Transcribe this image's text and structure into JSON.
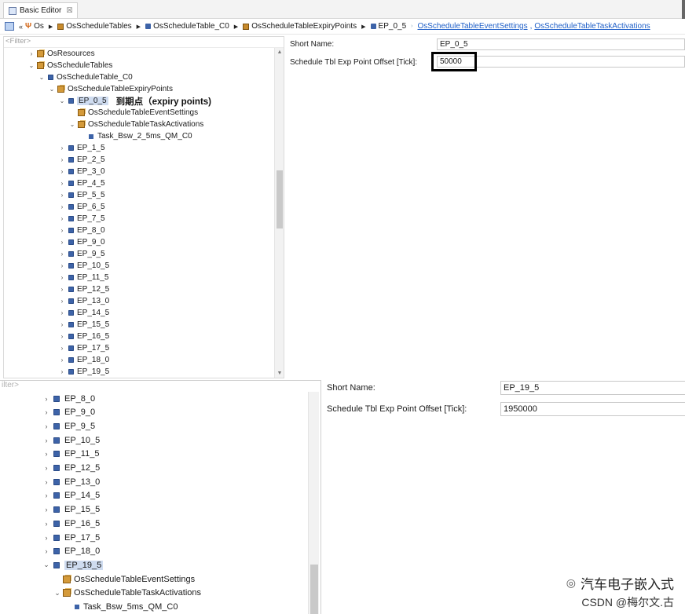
{
  "editor": {
    "tab_title": "Basic Editor",
    "tab_close": "☒"
  },
  "breadcrumb": {
    "items": [
      "Os",
      "OsScheduleTables",
      "OsScheduleTable_C0",
      "OsScheduleTableExpiryPoints",
      "EP_0_5"
    ],
    "links": [
      "OsScheduleTableEventSettings",
      "OsScheduleTableTaskActivations"
    ],
    "separator": ","
  },
  "upper_tree": {
    "filter_placeholder": "<Filter>",
    "nodes": [
      {
        "label": "OsResources",
        "level": 1,
        "toggle": ">",
        "icon": "module"
      },
      {
        "label": "OsScheduleTables",
        "level": 1,
        "toggle": "v",
        "icon": "module"
      },
      {
        "label": "OsScheduleTable_C0",
        "level": 2,
        "toggle": "v",
        "icon": "square"
      },
      {
        "label": "OsScheduleTableExpiryPoints",
        "level": 3,
        "toggle": "v",
        "icon": "module"
      },
      {
        "label": "EP_0_5",
        "level": 4,
        "toggle": "v",
        "icon": "square",
        "selected": true
      },
      {
        "label": "OsScheduleTableEventSettings",
        "level": 5,
        "toggle": "",
        "icon": "module"
      },
      {
        "label": "OsScheduleTableTaskActivations",
        "level": 5,
        "toggle": "v",
        "icon": "module"
      },
      {
        "label": "Task_Bsw_2_5ms_QM_C0",
        "level": 6,
        "toggle": "",
        "icon": "task"
      },
      {
        "label": "EP_1_5",
        "level": 4,
        "toggle": ">",
        "icon": "square"
      },
      {
        "label": "EP_2_5",
        "level": 4,
        "toggle": ">",
        "icon": "square"
      },
      {
        "label": "EP_3_0",
        "level": 4,
        "toggle": ">",
        "icon": "square"
      },
      {
        "label": "EP_4_5",
        "level": 4,
        "toggle": ">",
        "icon": "square"
      },
      {
        "label": "EP_5_5",
        "level": 4,
        "toggle": ">",
        "icon": "square"
      },
      {
        "label": "EP_6_5",
        "level": 4,
        "toggle": ">",
        "icon": "square"
      },
      {
        "label": "EP_7_5",
        "level": 4,
        "toggle": ">",
        "icon": "square"
      },
      {
        "label": "EP_8_0",
        "level": 4,
        "toggle": ">",
        "icon": "square"
      },
      {
        "label": "EP_9_0",
        "level": 4,
        "toggle": ">",
        "icon": "square"
      },
      {
        "label": "EP_9_5",
        "level": 4,
        "toggle": ">",
        "icon": "square"
      },
      {
        "label": "EP_10_5",
        "level": 4,
        "toggle": ">",
        "icon": "square"
      },
      {
        "label": "EP_11_5",
        "level": 4,
        "toggle": ">",
        "icon": "square"
      },
      {
        "label": "EP_12_5",
        "level": 4,
        "toggle": ">",
        "icon": "square"
      },
      {
        "label": "EP_13_0",
        "level": 4,
        "toggle": ">",
        "icon": "square"
      },
      {
        "label": "EP_14_5",
        "level": 4,
        "toggle": ">",
        "icon": "square"
      },
      {
        "label": "EP_15_5",
        "level": 4,
        "toggle": ">",
        "icon": "square"
      },
      {
        "label": "EP_16_5",
        "level": 4,
        "toggle": ">",
        "icon": "square"
      },
      {
        "label": "EP_17_5",
        "level": 4,
        "toggle": ">",
        "icon": "square"
      },
      {
        "label": "EP_18_0",
        "level": 4,
        "toggle": ">",
        "icon": "square"
      },
      {
        "label": "EP_19_5",
        "level": 4,
        "toggle": ">",
        "icon": "square"
      }
    ],
    "annotation": "到期点（expiry points)"
  },
  "upper_props": {
    "short_name_label": "Short Name:",
    "short_name_value": "EP_0_5",
    "offset_label": "Schedule Tbl Exp Point Offset [Tick]:",
    "offset_value": "50000"
  },
  "lower_tree": {
    "filter_placeholder": "ilter>",
    "nodes": [
      {
        "label": "EP_8_0",
        "level": 0,
        "toggle": ">",
        "icon": "square"
      },
      {
        "label": "EP_9_0",
        "level": 0,
        "toggle": ">",
        "icon": "square"
      },
      {
        "label": "EP_9_5",
        "level": 0,
        "toggle": ">",
        "icon": "square"
      },
      {
        "label": "EP_10_5",
        "level": 0,
        "toggle": ">",
        "icon": "square"
      },
      {
        "label": "EP_11_5",
        "level": 0,
        "toggle": ">",
        "icon": "square"
      },
      {
        "label": "EP_12_5",
        "level": 0,
        "toggle": ">",
        "icon": "square"
      },
      {
        "label": "EP_13_0",
        "level": 0,
        "toggle": ">",
        "icon": "square"
      },
      {
        "label": "EP_14_5",
        "level": 0,
        "toggle": ">",
        "icon": "square"
      },
      {
        "label": "EP_15_5",
        "level": 0,
        "toggle": ">",
        "icon": "square"
      },
      {
        "label": "EP_16_5",
        "level": 0,
        "toggle": ">",
        "icon": "square"
      },
      {
        "label": "EP_17_5",
        "level": 0,
        "toggle": ">",
        "icon": "square"
      },
      {
        "label": "EP_18_0",
        "level": 0,
        "toggle": ">",
        "icon": "square"
      },
      {
        "label": "EP_19_5",
        "level": 0,
        "toggle": "v",
        "icon": "square",
        "selected": true
      },
      {
        "label": "OsScheduleTableEventSettings",
        "level": 1,
        "toggle": "",
        "icon": "module"
      },
      {
        "label": "OsScheduleTableTaskActivations",
        "level": 1,
        "toggle": "v",
        "icon": "module"
      },
      {
        "label": "Task_Bsw_5ms_QM_C0",
        "level": 2,
        "toggle": "",
        "icon": "task"
      }
    ]
  },
  "lower_props": {
    "short_name_label": "Short Name:",
    "short_name_value": "EP_19_5",
    "offset_label": "Schedule Tbl Exp Point Offset [Tick]:",
    "offset_value": "1950000"
  },
  "watermark": {
    "line1": "汽车电子嵌入式",
    "line2": "CSDN @梅尔文.古"
  },
  "colors": {
    "link": "#2060c8",
    "selection": "#cfdcf0",
    "node_icon": "#3d63a8",
    "module_icon": "#d49a3a"
  }
}
